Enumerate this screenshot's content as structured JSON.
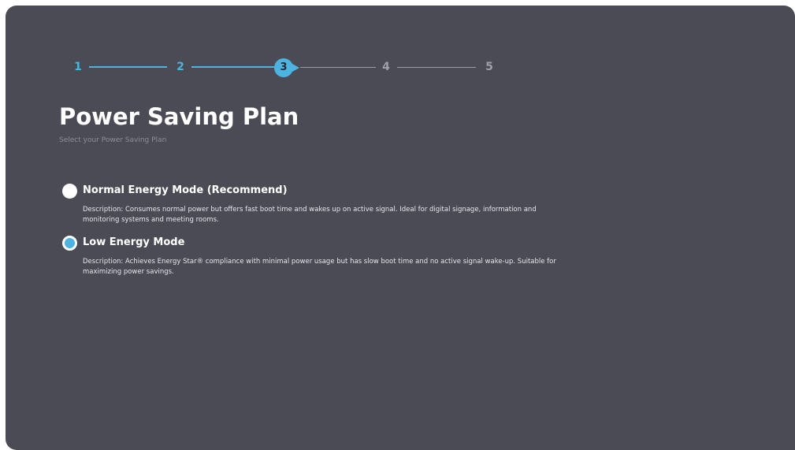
{
  "stepper": {
    "steps": [
      "1",
      "2",
      "3",
      "4",
      "5"
    ],
    "current_step": 3
  },
  "page": {
    "title": "Power Saving Plan",
    "subtitle": "Select your Power Saving Plan"
  },
  "options": [
    {
      "label": "Normal Energy Mode (Recommend)",
      "description": "Description: Consumes normal power but offers fast boot time and wakes up on active signal. Ideal for digital signage, information and monitoring systems and meeting rooms.",
      "selected": false
    },
    {
      "label": "Low Energy Mode",
      "description": "Description: Achieves Energy Star® compliance with minimal power usage but has slow boot time and no active signal wake-up. Suitable for maximizing power savings.",
      "selected": true
    }
  ],
  "colors": {
    "panel_bg": "#4b4b55",
    "accent": "#4db3e0",
    "text": "#ffffff",
    "muted": "#8e8e98"
  }
}
